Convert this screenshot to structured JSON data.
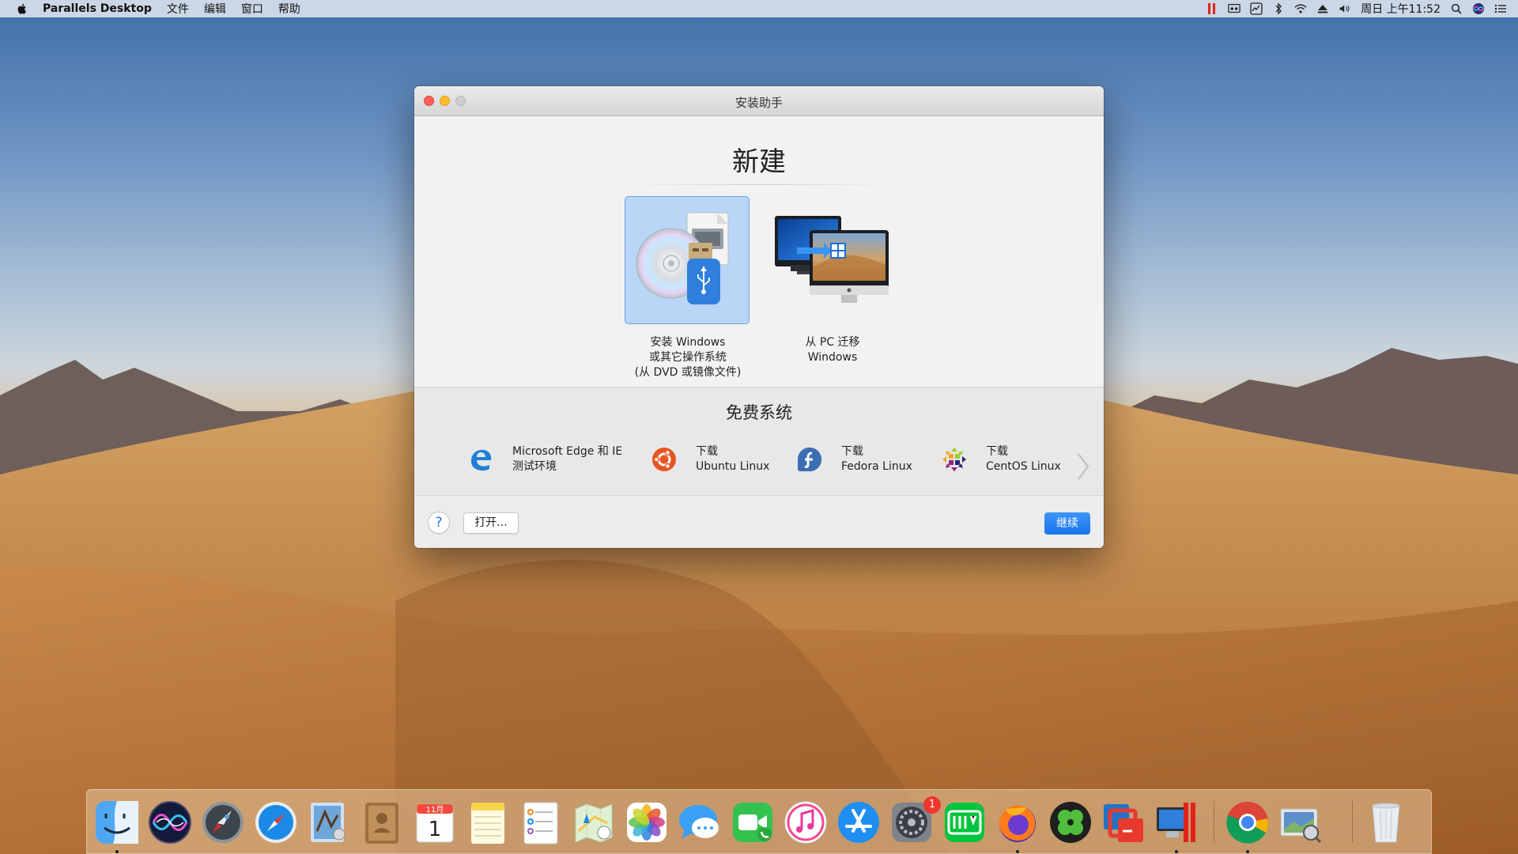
{
  "menubar": {
    "app_name": "Parallels Desktop",
    "menus": [
      "文件",
      "编辑",
      "窗口",
      "帮助"
    ],
    "clock": "周日 上午11:52",
    "status_icons": [
      "parallels-icon",
      "cast-icon",
      "activity-icon",
      "bluetooth-icon",
      "wifi-icon",
      "eject-icon",
      "volume-icon",
      "search-icon",
      "siri-icon",
      "list-icon"
    ]
  },
  "window": {
    "title": "安装助手",
    "heading": "新建",
    "options": [
      {
        "lines": [
          "安装 Windows",
          "或其它操作系统",
          "(从 DVD 或镜像文件)"
        ],
        "selected": true,
        "icon": "install-media-icon"
      },
      {
        "lines": [
          "从 PC 迁移",
          "Windows"
        ],
        "selected": false,
        "icon": "pc-migrate-icon"
      }
    ],
    "free_title": "免费系统",
    "free_items": [
      {
        "lines": [
          "Microsoft Edge 和 IE",
          "测试环境"
        ],
        "icon": "edge-icon"
      },
      {
        "lines": [
          "下载",
          "Ubuntu Linux"
        ],
        "icon": "ubuntu-icon"
      },
      {
        "lines": [
          "下载",
          "Fedora Linux"
        ],
        "icon": "fedora-icon"
      },
      {
        "lines": [
          "下载",
          "CentOS Linux"
        ],
        "icon": "centos-icon"
      }
    ],
    "help_label": "?",
    "open_label": "打开...",
    "continue_label": "继续"
  },
  "dock": {
    "calendar_month": "11月",
    "calendar_day": "1",
    "system_prefs_badge": "1",
    "items": [
      "finder-icon",
      "siri-icon",
      "launchpad-icon",
      "safari-icon",
      "mail-icon",
      "contacts-icon",
      "calendar-icon",
      "notes-icon",
      "reminders-icon",
      "maps-icon",
      "photos-icon",
      "messages-icon",
      "facetime-icon",
      "itunes-icon",
      "app-store-icon",
      "system-preferences-icon",
      "iqiyi-icon",
      "firefox-icon",
      "clover-icon",
      "vmware-icon",
      "parallels-desktop-icon",
      "chrome-icon",
      "preview-icon",
      "trash-icon"
    ]
  }
}
